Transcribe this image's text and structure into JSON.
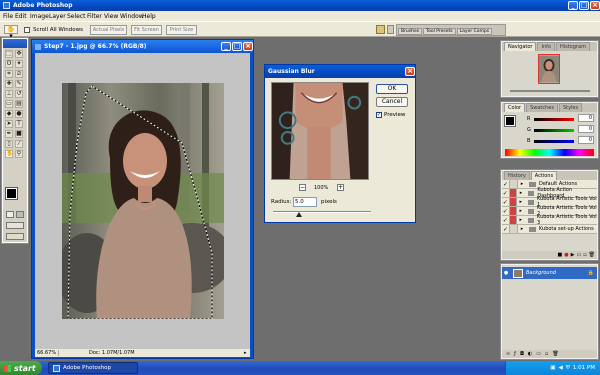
{
  "app": {
    "title": "Adobe Photoshop"
  },
  "menu": [
    "File",
    "Edit",
    "Image",
    "Layer",
    "Select",
    "Filter",
    "View",
    "Window",
    "Help"
  ],
  "options_bar": {
    "scroll_all_windows": "Scroll All Windows",
    "buttons": [
      "Actual Pixels",
      "Fit Screen",
      "Print Size"
    ],
    "well_tabs": [
      "Brushes",
      "Tool Presets",
      "Layer Comps"
    ]
  },
  "document": {
    "title": "Step7 - 1.jpg @ 66.7% (RGB/8)",
    "zoom": "66.67%",
    "doc_info": "Doc: 1.07M/1.07M"
  },
  "gaussian_blur": {
    "title": "Gaussian Blur",
    "ok": "OK",
    "cancel": "Cancel",
    "preview": "Preview",
    "zoom": "100%",
    "zoom_out": "−",
    "zoom_in": "+",
    "radius_label": "Radius:",
    "radius_value": "5.0",
    "units": "pixels",
    "radius_slider": 0.27
  },
  "navigator": {
    "tabs": [
      "Navigator",
      "Info",
      "Histogram"
    ]
  },
  "color": {
    "tabs": [
      "Color",
      "Swatches",
      "Styles"
    ],
    "channels": [
      "R",
      "G",
      "B"
    ],
    "values": [
      "0",
      "0",
      "0"
    ]
  },
  "history_actions": {
    "tabs": [
      "History",
      "Actions"
    ],
    "items": [
      {
        "label": "Default Actions",
        "red": false
      },
      {
        "label": "Kubota Action Dashboard",
        "red": true
      },
      {
        "label": "Kubota Artistic Tools Vol 1",
        "red": true
      },
      {
        "label": "Kubota Artistic Tools Vol 2",
        "red": true
      },
      {
        "label": "Kubota Artistic Tools Vol 3",
        "red": true
      },
      {
        "label": "Kubota set-up Actions",
        "red": false
      }
    ]
  },
  "layers": {
    "background": "Background"
  },
  "taskbar": {
    "start": "start",
    "task": "Adobe Photoshop",
    "time": "1:01 PM"
  },
  "colors": {
    "xp_blue": "#0a5fd8",
    "start_green": "#3c9a3c",
    "workspace": "#6e6e6e"
  }
}
